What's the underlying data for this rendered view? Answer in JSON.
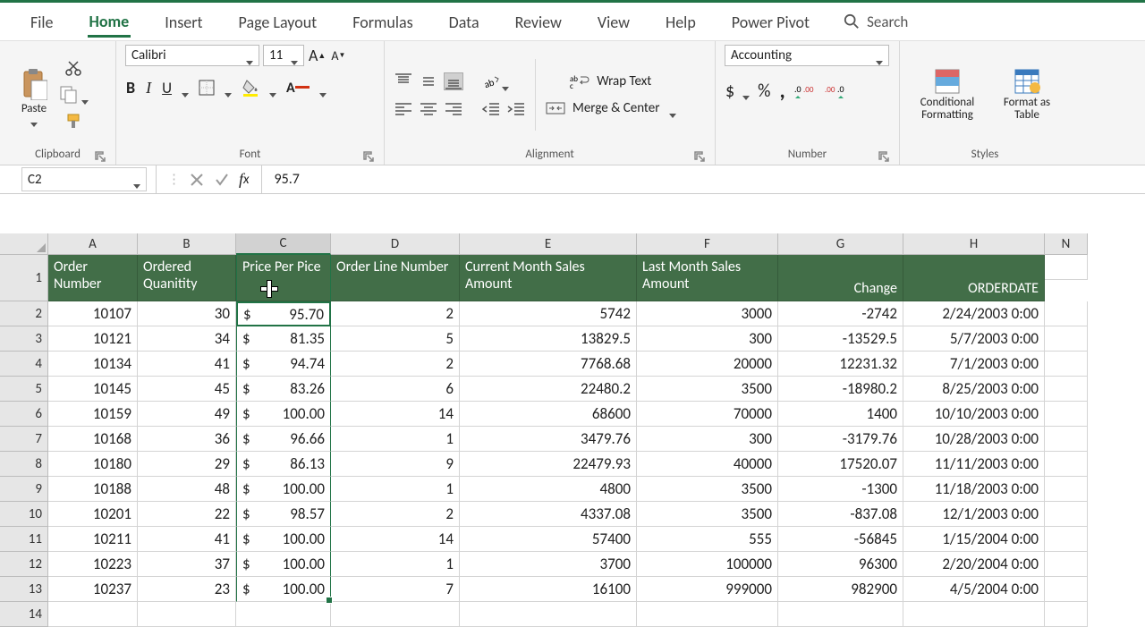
{
  "tabs": [
    "File",
    "Home",
    "Insert",
    "Page Layout",
    "Formulas",
    "Data",
    "Review",
    "View",
    "Help",
    "Power Pivot"
  ],
  "activeTab": "Home",
  "search_placeholder": "Search",
  "ribbon": {
    "clipboard": {
      "paste": "Paste",
      "label": "Clipboard"
    },
    "font": {
      "name": "Calibri",
      "size": "11",
      "label": "Font"
    },
    "alignment": {
      "wrap": "Wrap Text",
      "merge": "Merge & Center",
      "label": "Alignment"
    },
    "number": {
      "format": "Accounting",
      "label": "Number"
    },
    "styles": {
      "cond": "Conditional Formatting",
      "table": "Format as Table",
      "label": "Styles"
    }
  },
  "namebox": "C2",
  "formula": "95.7",
  "columns": [
    "A",
    "B",
    "C",
    "D",
    "E",
    "F",
    "G",
    "H",
    "N"
  ],
  "selectedCol": "C",
  "headers": [
    "Order Number",
    "Ordered Quanitity",
    "Price Per Pice",
    "Order Line Number",
    "Current Month Sales Amount",
    "Last Month Sales Amount",
    "Change",
    "ORDERDATE"
  ],
  "rows": [
    {
      "n": 2,
      "a": "10107",
      "b": "30",
      "c": "95.70",
      "d": "2",
      "e": "5742",
      "f": "3000",
      "g": "-2742",
      "h": "2/24/2003 0:00"
    },
    {
      "n": 3,
      "a": "10121",
      "b": "34",
      "c": "81.35",
      "d": "5",
      "e": "13829.5",
      "f": "300",
      "g": "-13529.5",
      "h": "5/7/2003 0:00"
    },
    {
      "n": 4,
      "a": "10134",
      "b": "41",
      "c": "94.74",
      "d": "2",
      "e": "7768.68",
      "f": "20000",
      "g": "12231.32",
      "h": "7/1/2003 0:00"
    },
    {
      "n": 5,
      "a": "10145",
      "b": "45",
      "c": "83.26",
      "d": "6",
      "e": "22480.2",
      "f": "3500",
      "g": "-18980.2",
      "h": "8/25/2003 0:00"
    },
    {
      "n": 6,
      "a": "10159",
      "b": "49",
      "c": "100.00",
      "d": "14",
      "e": "68600",
      "f": "70000",
      "g": "1400",
      "h": "10/10/2003 0:00"
    },
    {
      "n": 7,
      "a": "10168",
      "b": "36",
      "c": "96.66",
      "d": "1",
      "e": "3479.76",
      "f": "300",
      "g": "-3179.76",
      "h": "10/28/2003 0:00"
    },
    {
      "n": 8,
      "a": "10180",
      "b": "29",
      "c": "86.13",
      "d": "9",
      "e": "22479.93",
      "f": "40000",
      "g": "17520.07",
      "h": "11/11/2003 0:00"
    },
    {
      "n": 9,
      "a": "10188",
      "b": "48",
      "c": "100.00",
      "d": "1",
      "e": "4800",
      "f": "3500",
      "g": "-1300",
      "h": "11/18/2003 0:00"
    },
    {
      "n": 10,
      "a": "10201",
      "b": "22",
      "c": "98.57",
      "d": "2",
      "e": "4337.08",
      "f": "3500",
      "g": "-837.08",
      "h": "12/1/2003 0:00"
    },
    {
      "n": 11,
      "a": "10211",
      "b": "41",
      "c": "100.00",
      "d": "14",
      "e": "57400",
      "f": "555",
      "g": "-56845",
      "h": "1/15/2004 0:00"
    },
    {
      "n": 12,
      "a": "10223",
      "b": "37",
      "c": "100.00",
      "d": "1",
      "e": "3700",
      "f": "100000",
      "g": "96300",
      "h": "2/20/2004 0:00"
    },
    {
      "n": 13,
      "a": "10237",
      "b": "23",
      "c": "100.00",
      "d": "7",
      "e": "16100",
      "f": "999000",
      "g": "982900",
      "h": "4/5/2004 0:00"
    }
  ],
  "lastRow": 14
}
